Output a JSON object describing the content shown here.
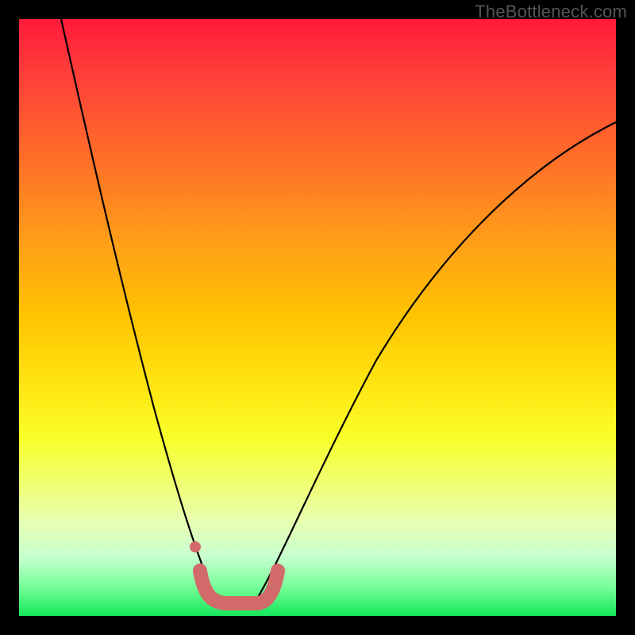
{
  "watermark": {
    "text": "TheBottleneck.com"
  },
  "chart_data": {
    "type": "line",
    "title": "",
    "xlabel": "",
    "ylabel": "",
    "xlim": [
      0,
      100
    ],
    "ylim": [
      0,
      100
    ],
    "grid": false,
    "series": [
      {
        "name": "left-curve",
        "color": "#000000",
        "x": [
          7,
          10,
          13,
          16,
          19,
          22,
          25,
          28,
          31,
          33
        ],
        "y": [
          100,
          80,
          62,
          47,
          34,
          24,
          16,
          10,
          6,
          3
        ]
      },
      {
        "name": "right-curve",
        "color": "#000000",
        "x": [
          40,
          44,
          50,
          56,
          62,
          70,
          78,
          86,
          94,
          100
        ],
        "y": [
          3,
          7,
          15,
          25,
          35,
          48,
          60,
          70,
          78,
          83
        ]
      },
      {
        "name": "valley-marker",
        "color": "#d26a6a",
        "x": [
          30,
          31,
          33,
          35,
          37,
          39,
          41,
          42
        ],
        "y": [
          7.5,
          3.5,
          2.5,
          2.3,
          2.3,
          2.5,
          3.5,
          7.5
        ]
      }
    ],
    "annotations": [
      {
        "name": "dot",
        "x": 29.5,
        "y": 11.5,
        "color": "#d26a6a"
      }
    ]
  }
}
